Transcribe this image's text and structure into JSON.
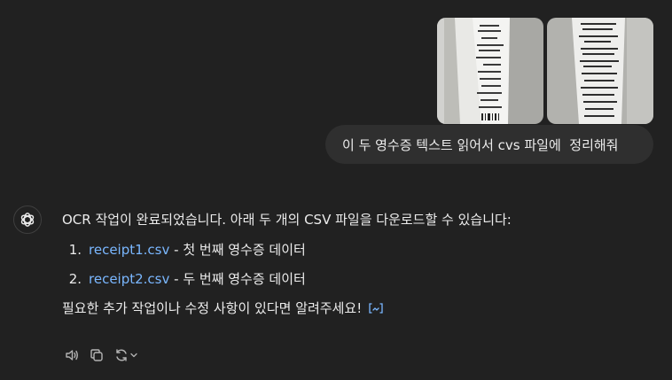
{
  "user_message": {
    "attachments": [
      {
        "icon": "receipt-photo-1"
      },
      {
        "icon": "receipt-photo-2"
      }
    ],
    "text": "이 두 영수증 텍스트 읽어서 cvs 파일에  정리해줘"
  },
  "assistant_message": {
    "avatar_icon": "openai-logo-icon",
    "intro": "OCR 작업이 완료되었습니다. 아래 두 개의 CSV 파일을 다운로드할 수 있습니다:",
    "files": [
      {
        "number": "1.",
        "link": "receipt1.csv",
        "description": " - 첫 번째 영수증 데이터"
      },
      {
        "number": "2.",
        "link": "receipt2.csv",
        "description": " - 두 번째 영수증 데이터"
      }
    ],
    "closing": "필요한 추가 작업이나 수정 사항이 있다면 알려주세요!",
    "source_badge_icon": "code-brackets-icon"
  },
  "actions": [
    {
      "icon": "speaker-icon"
    },
    {
      "icon": "copy-icon"
    },
    {
      "icon": "regenerate-icon"
    }
  ],
  "colors": {
    "background": "#212121",
    "user_bubble": "#2f2f2f",
    "link": "#7ab7ff",
    "text": "#ececec",
    "icon": "#b4b4b4"
  }
}
